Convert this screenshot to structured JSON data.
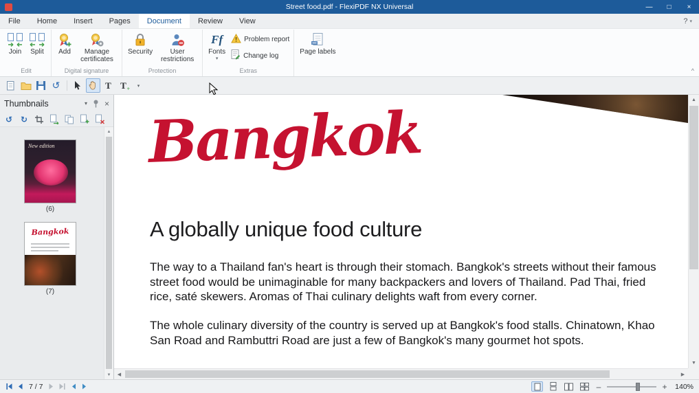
{
  "window": {
    "title": "Street food.pdf - FlexiPDF NX Universal"
  },
  "tabs": {
    "items": [
      "File",
      "Home",
      "Insert",
      "Pages",
      "Document",
      "Review",
      "View"
    ],
    "active": "Document",
    "help": "?"
  },
  "ribbon": {
    "groups": [
      {
        "label": "Edit",
        "buttons": [
          {
            "label": "Join"
          },
          {
            "label": "Split"
          }
        ]
      },
      {
        "label": "Digital signature",
        "buttons": [
          {
            "label": "Add"
          },
          {
            "label": "Manage certificates"
          }
        ]
      },
      {
        "label": "Protection",
        "buttons": [
          {
            "label": "Security"
          },
          {
            "label": "User restrictions"
          }
        ]
      },
      {
        "label": "Extras",
        "buttons": [
          {
            "label": "Fonts"
          },
          {
            "label": "Problem report"
          },
          {
            "label": "Change log"
          }
        ]
      },
      {
        "label": "",
        "buttons": [
          {
            "label": "Page labels"
          }
        ]
      }
    ]
  },
  "quickbar": {
    "tools": [
      "page",
      "open-folder",
      "save",
      "undo",
      "select-tool",
      "hand-tool",
      "edit-text-tool",
      "add-text-tool",
      "overflow"
    ],
    "active_tool": "hand-tool"
  },
  "panel": {
    "title": "Thumbnails"
  },
  "thumbnails": {
    "items": [
      {
        "label": "(6)",
        "caption": "New edition"
      },
      {
        "label": "(7)",
        "caption": "Bangkok"
      }
    ]
  },
  "document": {
    "brand": "Bangkok",
    "heading": "A globally unique food culture",
    "para1": "The way to a Thailand fan's heart is through their stomach. Bangkok's streets without their famous street food would be unimaginable for many backpackers and lovers of Thailand.  Pad Thai, fried rice, saté skewers. Aromas of Thai culinary delights waft from every corner.",
    "para2": "The whole culinary diversity of the country is served up at Bangkok's food stalls. Chinatown, Khao San Road and Rambuttri Road are just a few of Bangkok's many gourmet hot spots."
  },
  "statusbar": {
    "page_indicator": "7 / 7",
    "zoom": "140%"
  },
  "icons": {
    "minimize": "—",
    "maximize": "□",
    "close": "×",
    "caret_down": "▾",
    "fonts_glyph": "Ff",
    "undo": "↺",
    "rotate_left": "↺",
    "rotate_right": "↻",
    "text_tool": "T",
    "collapse_ribbon": "^",
    "zoom_out": "–",
    "zoom_in": "+",
    "scroll_up": "▲",
    "scroll_down": "▼",
    "scroll_left": "◀",
    "scroll_right": "▶"
  },
  "colors": {
    "titlebar_blue": "#1d5b9a",
    "accent_blue": "#2d6bb4",
    "brand_red": "#c51230"
  }
}
